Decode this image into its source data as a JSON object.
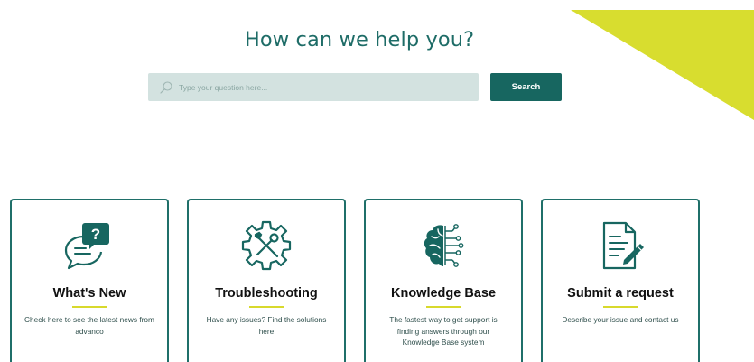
{
  "hero": {
    "title": "How can we help you?"
  },
  "search": {
    "placeholder": "Type your question here...",
    "button_label": "Search"
  },
  "colors": {
    "brand_teal": "#176660",
    "accent_yellow": "#d8d92c",
    "search_bg": "#d3e2e0"
  },
  "cards": [
    {
      "title": "What's New",
      "description": "Check here to see the latest news from advanco",
      "icon": "chat-question-icon"
    },
    {
      "title": "Troubleshooting",
      "description": "Have any issues? Find the solutions here",
      "icon": "gear-tools-icon"
    },
    {
      "title": "Knowledge Base",
      "description": "The fastest way to get support is finding answers through our Knowledge Base system",
      "icon": "brain-circuit-icon"
    },
    {
      "title": "Submit a request",
      "description": "Describe your issue and contact us",
      "icon": "document-pen-icon"
    }
  ]
}
